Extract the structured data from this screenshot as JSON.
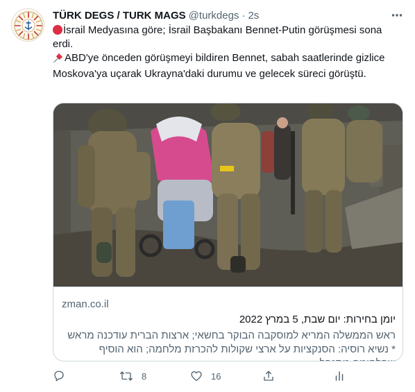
{
  "tweet": {
    "author_name": "TÜRK DEGS / TURK MAGS",
    "author_handle": "@turkdegs",
    "separator": "·",
    "time": "2s",
    "paragraph1": "İsrail Medyasına göre; İsrail Başbakanı Bennet-Putin görüşmesi sona erdi.",
    "paragraph2": "ABD'ye önceden görüşmeyi bildiren Bennet, sabah saatlerinde gizlice Moskova'ya uçarak Ukrayna'daki durumu ve gelecek süreci görüştü.",
    "emoji1": "red-circle-icon",
    "emoji2": "pushpin-icon"
  },
  "card": {
    "domain": "zman.co.il",
    "title": "יומן בחירות: יום שבת, 5 במרץ 2022",
    "description": "ראש הממשלה המריא למוסקבה הבוקר בחשאי; ארצות הברית עודכנה מראש * נשיא רוסיה: הסנקציות על ארצי שקולות להכרזת מלחמה; הוא הוסיף שהלחימה מתנהל..."
  },
  "actions": {
    "retweets": "8",
    "likes": "16",
    "icons": [
      "reply-icon",
      "retweet-icon",
      "like-icon",
      "share-icon",
      "analytics-icon"
    ]
  },
  "colors": {
    "text": "#0f1419",
    "secondary": "#536471",
    "border": "#cfd9de",
    "red": "#dd2e44"
  }
}
